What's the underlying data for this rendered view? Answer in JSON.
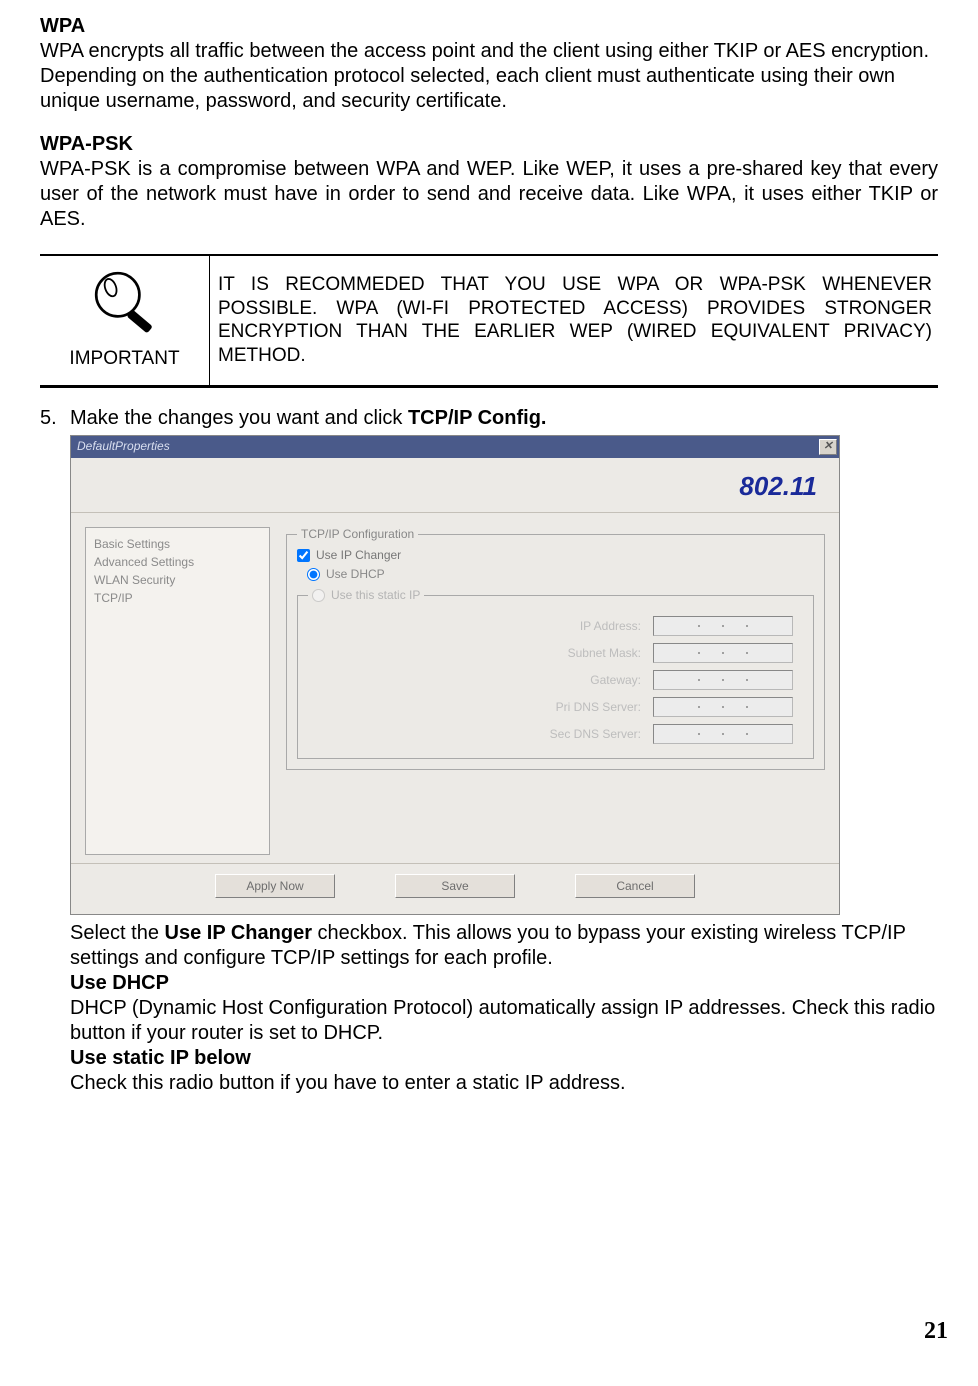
{
  "wpa": {
    "heading": "WPA",
    "body": "WPA encrypts all traffic between the access point and the client using either TKIP or AES encryption. Depending on the authentication protocol selected, each client must authenticate using their own unique username, password, and security certificate."
  },
  "wpa_psk": {
    "heading": "WPA-PSK",
    "body": "WPA-PSK is a compromise between WPA and WEP. Like WEP, it uses a pre-shared key that every user of the network must have in order to send and receive data. Like WPA, it uses either TKIP or AES."
  },
  "important": {
    "label": "IMPORTANT",
    "text": "IT IS RECOMMEDED THAT YOU USE WPA OR WPA-PSK WHENEVER POSSIBLE. WPA (WI-FI PROTECTED ACCESS) PROVIDES STRONGER ENCRYPTION THAN THE EARLIER WEP (WIRED EQUIVALENT PRIVACY) METHOD."
  },
  "step5": {
    "number": "5.",
    "text_before": "Make the changes you want and click ",
    "bold": "TCP/IP Config."
  },
  "dialog": {
    "title": "DefaultProperties",
    "banner": "802.11",
    "sidebar": [
      "Basic Settings",
      "Advanced Settings",
      "WLAN Security",
      "TCP/IP"
    ],
    "group_label": "TCP/IP Configuration",
    "checkbox_label": "Use IP Changer",
    "radio_dhcp": "Use DHCP",
    "radio_static": "Use this static IP",
    "fields": [
      "IP Address:",
      "Subnet Mask:",
      "Gateway:",
      "Pri DNS Server:",
      "Sec DNS Server:"
    ],
    "buttons": {
      "apply": "Apply Now",
      "save": "Save",
      "cancel": "Cancel"
    }
  },
  "followup": {
    "p1a": "Select the ",
    "p1b": "Use IP Changer",
    "p1c": " checkbox. This allows you to bypass your existing wireless TCP/IP settings and configure TCP/IP settings for each profile.",
    "h2": "Use DHCP",
    "p2": "DHCP (Dynamic Host Configuration Protocol) automatically assign IP addresses. Check this radio button if your router is set to DHCP.",
    "h3": "Use static IP below",
    "p3": "Check this radio button if you have to enter a static IP address."
  },
  "page_number": "21"
}
